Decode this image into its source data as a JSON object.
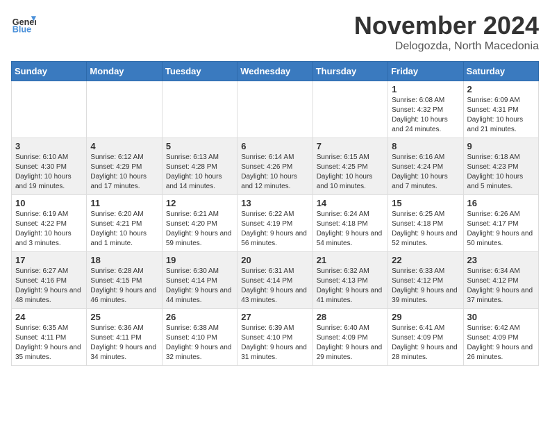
{
  "header": {
    "logo_general": "General",
    "logo_blue": "Blue",
    "month_title": "November 2024",
    "location": "Delogozda, North Macedonia"
  },
  "weekdays": [
    "Sunday",
    "Monday",
    "Tuesday",
    "Wednesday",
    "Thursday",
    "Friday",
    "Saturday"
  ],
  "weeks": [
    [
      {
        "day": "",
        "info": ""
      },
      {
        "day": "",
        "info": ""
      },
      {
        "day": "",
        "info": ""
      },
      {
        "day": "",
        "info": ""
      },
      {
        "day": "",
        "info": ""
      },
      {
        "day": "1",
        "info": "Sunrise: 6:08 AM\nSunset: 4:32 PM\nDaylight: 10 hours and 24 minutes."
      },
      {
        "day": "2",
        "info": "Sunrise: 6:09 AM\nSunset: 4:31 PM\nDaylight: 10 hours and 21 minutes."
      }
    ],
    [
      {
        "day": "3",
        "info": "Sunrise: 6:10 AM\nSunset: 4:30 PM\nDaylight: 10 hours and 19 minutes."
      },
      {
        "day": "4",
        "info": "Sunrise: 6:12 AM\nSunset: 4:29 PM\nDaylight: 10 hours and 17 minutes."
      },
      {
        "day": "5",
        "info": "Sunrise: 6:13 AM\nSunset: 4:28 PM\nDaylight: 10 hours and 14 minutes."
      },
      {
        "day": "6",
        "info": "Sunrise: 6:14 AM\nSunset: 4:26 PM\nDaylight: 10 hours and 12 minutes."
      },
      {
        "day": "7",
        "info": "Sunrise: 6:15 AM\nSunset: 4:25 PM\nDaylight: 10 hours and 10 minutes."
      },
      {
        "day": "8",
        "info": "Sunrise: 6:16 AM\nSunset: 4:24 PM\nDaylight: 10 hours and 7 minutes."
      },
      {
        "day": "9",
        "info": "Sunrise: 6:18 AM\nSunset: 4:23 PM\nDaylight: 10 hours and 5 minutes."
      }
    ],
    [
      {
        "day": "10",
        "info": "Sunrise: 6:19 AM\nSunset: 4:22 PM\nDaylight: 10 hours and 3 minutes."
      },
      {
        "day": "11",
        "info": "Sunrise: 6:20 AM\nSunset: 4:21 PM\nDaylight: 10 hours and 1 minute."
      },
      {
        "day": "12",
        "info": "Sunrise: 6:21 AM\nSunset: 4:20 PM\nDaylight: 9 hours and 59 minutes."
      },
      {
        "day": "13",
        "info": "Sunrise: 6:22 AM\nSunset: 4:19 PM\nDaylight: 9 hours and 56 minutes."
      },
      {
        "day": "14",
        "info": "Sunrise: 6:24 AM\nSunset: 4:18 PM\nDaylight: 9 hours and 54 minutes."
      },
      {
        "day": "15",
        "info": "Sunrise: 6:25 AM\nSunset: 4:18 PM\nDaylight: 9 hours and 52 minutes."
      },
      {
        "day": "16",
        "info": "Sunrise: 6:26 AM\nSunset: 4:17 PM\nDaylight: 9 hours and 50 minutes."
      }
    ],
    [
      {
        "day": "17",
        "info": "Sunrise: 6:27 AM\nSunset: 4:16 PM\nDaylight: 9 hours and 48 minutes."
      },
      {
        "day": "18",
        "info": "Sunrise: 6:28 AM\nSunset: 4:15 PM\nDaylight: 9 hours and 46 minutes."
      },
      {
        "day": "19",
        "info": "Sunrise: 6:30 AM\nSunset: 4:14 PM\nDaylight: 9 hours and 44 minutes."
      },
      {
        "day": "20",
        "info": "Sunrise: 6:31 AM\nSunset: 4:14 PM\nDaylight: 9 hours and 43 minutes."
      },
      {
        "day": "21",
        "info": "Sunrise: 6:32 AM\nSunset: 4:13 PM\nDaylight: 9 hours and 41 minutes."
      },
      {
        "day": "22",
        "info": "Sunrise: 6:33 AM\nSunset: 4:12 PM\nDaylight: 9 hours and 39 minutes."
      },
      {
        "day": "23",
        "info": "Sunrise: 6:34 AM\nSunset: 4:12 PM\nDaylight: 9 hours and 37 minutes."
      }
    ],
    [
      {
        "day": "24",
        "info": "Sunrise: 6:35 AM\nSunset: 4:11 PM\nDaylight: 9 hours and 35 minutes."
      },
      {
        "day": "25",
        "info": "Sunrise: 6:36 AM\nSunset: 4:11 PM\nDaylight: 9 hours and 34 minutes."
      },
      {
        "day": "26",
        "info": "Sunrise: 6:38 AM\nSunset: 4:10 PM\nDaylight: 9 hours and 32 minutes."
      },
      {
        "day": "27",
        "info": "Sunrise: 6:39 AM\nSunset: 4:10 PM\nDaylight: 9 hours and 31 minutes."
      },
      {
        "day": "28",
        "info": "Sunrise: 6:40 AM\nSunset: 4:09 PM\nDaylight: 9 hours and 29 minutes."
      },
      {
        "day": "29",
        "info": "Sunrise: 6:41 AM\nSunset: 4:09 PM\nDaylight: 9 hours and 28 minutes."
      },
      {
        "day": "30",
        "info": "Sunrise: 6:42 AM\nSunset: 4:09 PM\nDaylight: 9 hours and 26 minutes."
      }
    ]
  ]
}
